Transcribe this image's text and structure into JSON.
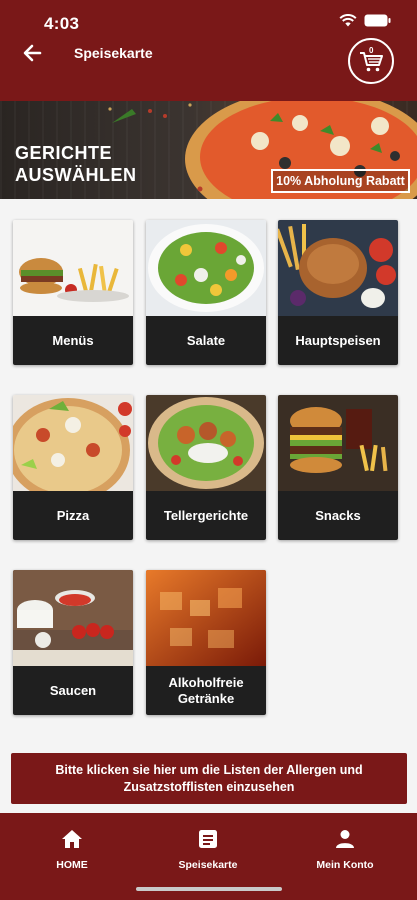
{
  "status": {
    "time": "4:03"
  },
  "header": {
    "title": "Speisekarte",
    "cart_count": "0"
  },
  "banner": {
    "line1": "GERICHTE",
    "line2": "AUSWÄHLEN",
    "badge": "10% Abholung Rabatt"
  },
  "categories": [
    {
      "label": "Menüs"
    },
    {
      "label": "Salate"
    },
    {
      "label": "Hauptspeisen"
    },
    {
      "label": "Pizza"
    },
    {
      "label": "Tellergerichte"
    },
    {
      "label": "Snacks"
    },
    {
      "label": "Saucen"
    },
    {
      "label": "Alkoholfreie Getränke"
    }
  ],
  "allergen_notice": "Bitte klicken sie hier um die Listen der Allergen und Zusatzstofflisten einzusehen",
  "nav": [
    {
      "label": "HOME",
      "icon": "home-icon"
    },
    {
      "label": "Speisekarte",
      "icon": "menu-book-icon"
    },
    {
      "label": "Mein Konto",
      "icon": "account-icon"
    }
  ],
  "colors": {
    "brand": "#7a1818",
    "card_label_bg": "#1f1f1f"
  }
}
